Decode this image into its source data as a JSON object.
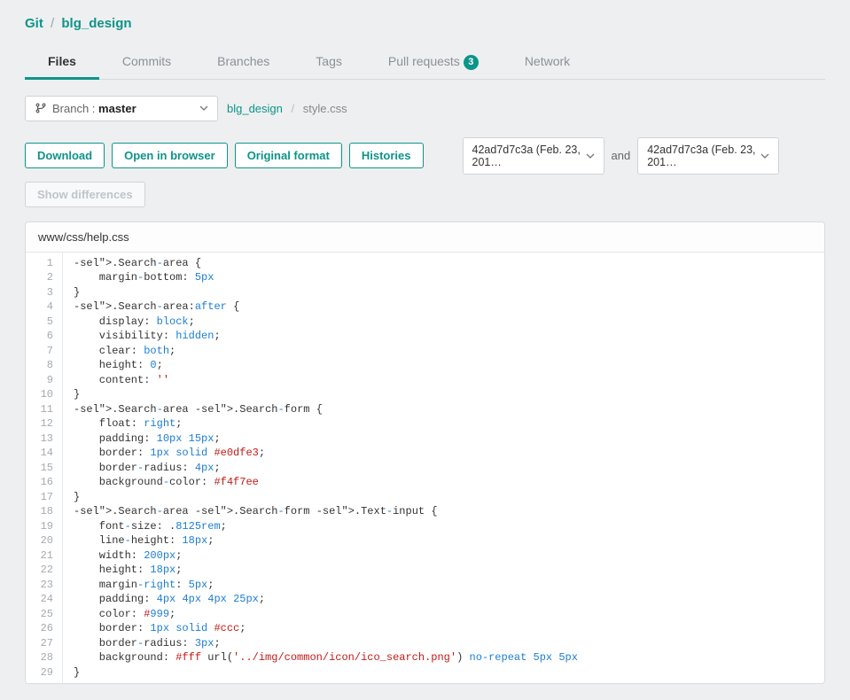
{
  "breadcrumb": {
    "root": "Git",
    "repo": "blg_design"
  },
  "tabs": [
    {
      "label": "Files",
      "active": true
    },
    {
      "label": "Commits"
    },
    {
      "label": "Branches"
    },
    {
      "label": "Tags"
    },
    {
      "label": "Pull requests",
      "badge": "3"
    },
    {
      "label": "Network"
    }
  ],
  "branch": {
    "prefix": "Branch : ",
    "name": "master"
  },
  "path": {
    "dir": "blg_design",
    "file": "style.css"
  },
  "buttons": {
    "download": "Download",
    "open": "Open in browser",
    "original": "Original format",
    "histories": "Histories",
    "diff": "Show differences"
  },
  "compare": {
    "left": "42ad7d7c3a (Feb. 23, 201…",
    "and": "and",
    "right": "42ad7d7c3a (Feb. 23, 201…"
  },
  "file": {
    "header": "www/css/help.css"
  },
  "code_lines": [
    ".Search-area {",
    "    margin-bottom: 5px",
    "}",
    ".Search-area:after {",
    "    display: block;",
    "    visibility: hidden;",
    "    clear: both;",
    "    height: 0;",
    "    content: ''",
    "}",
    ".Search-area .Search-form {",
    "    float: right;",
    "    padding: 10px 15px;",
    "    border: 1px solid #e0dfe3;",
    "    border-radius: 4px;",
    "    background-color: #f4f7ee",
    "}",
    ".Search-area .Search-form .Text-input {",
    "    font-size: .8125rem;",
    "    line-height: 18px;",
    "    width: 200px;",
    "    height: 18px;",
    "    margin-right: 5px;",
    "    padding: 4px 4px 4px 25px;",
    "    color: #999;",
    "    border: 1px solid #ccc;",
    "    border-radius: 3px;",
    "    background: #fff url('../img/common/icon/ico_search.png') no-repeat 5px 5px",
    "}"
  ]
}
